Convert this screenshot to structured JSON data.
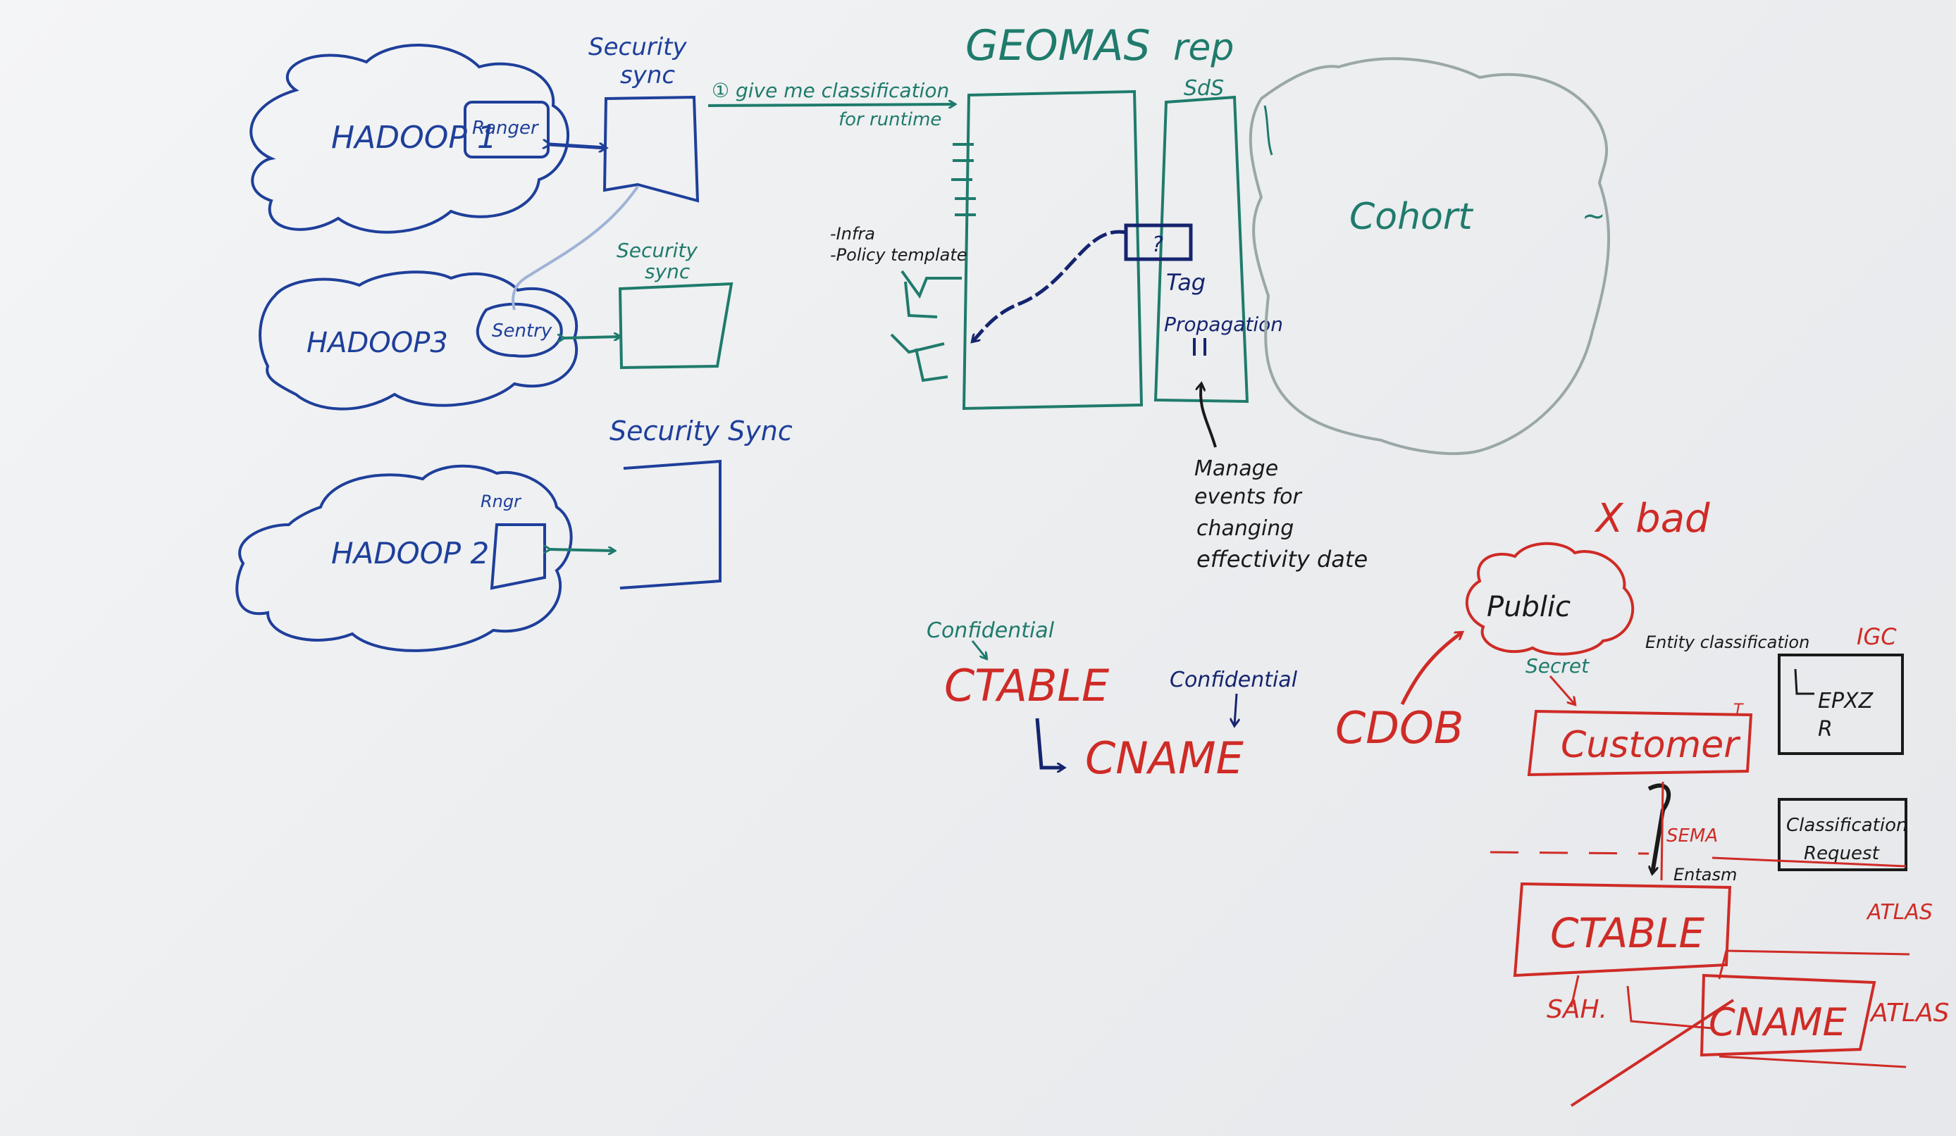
{
  "colors": {
    "blue": "#1e3f9a",
    "navy": "#15246e",
    "teal": "#1f7b6c",
    "red": "#cf2b26",
    "black": "#1a1a1a",
    "board": "#eceef0"
  },
  "clusters": {
    "hadoop1": "HADOOP 1",
    "hadoop1_box": "Ranger",
    "hadoop3": "HADOOP3",
    "hadoop3_box": "Sentry",
    "hadoop2": "HADOOP 2",
    "hadoop2_box": "Rngr"
  },
  "sync": {
    "top_label_1": "Security",
    "top_label_2": "sync",
    "mid_label_1": "Security",
    "mid_label_2": "sync",
    "bottom_label": "Security Sync"
  },
  "flow": {
    "step1": "① give me classification",
    "step1b": "for runtime"
  },
  "geomas": {
    "title": "GEOMAS",
    "rep": "rep",
    "sds": "SdS",
    "question": "?",
    "tag_1": "Tag",
    "tag_2": "Propagation",
    "infra_1": "-Infra",
    "infra_2": "-Policy template"
  },
  "cohort": {
    "label": "Cohort",
    "tilde": "~"
  },
  "notes": {
    "line1": "Manage",
    "line2": "events for",
    "line3": "changing",
    "line4": "effectivity date"
  },
  "classification": {
    "conf1": "Confidential",
    "ctable": "CTABLE",
    "conf2": "Confidential",
    "cname": "CNAME",
    "cdob": "CDOB"
  },
  "right": {
    "xbad": "X bad",
    "public": "Public",
    "entity_class": "Entity classification",
    "igc": "IGC",
    "secret": "Secret",
    "customer": "Customer",
    "t_mark": "T",
    "epxz_1": "EPXZ",
    "epxz_2": "R",
    "class_req_1": "Classification",
    "class_req_2": "Request",
    "sema": "SEMA",
    "entasm": "Entasm",
    "ctable": "CTABLE",
    "atlas1": "ATLAS",
    "cname": "CNAME",
    "atlas2": "ATLAS",
    "sah": "SAH."
  }
}
